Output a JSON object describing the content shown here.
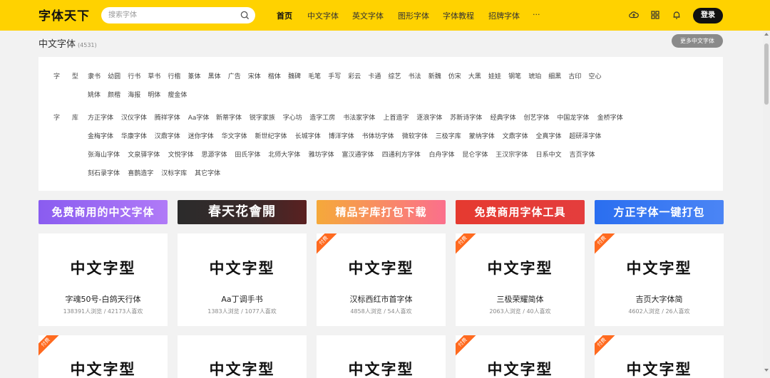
{
  "header": {
    "logo": "字体天下",
    "search_placeholder": "搜索字体",
    "nav": [
      "首页",
      "中文字体",
      "英文字体",
      "图形字体",
      "字体教程",
      "招牌字体",
      "···"
    ],
    "login_label": "登录",
    "icons": [
      "upload-icon",
      "grid-icon",
      "bell-icon"
    ]
  },
  "section": {
    "title": "中文字体",
    "count": "(4531)",
    "more_label": "更多中文字体"
  },
  "filters": {
    "type_label": "字 型",
    "types_row1": [
      "隶书",
      "幼圆",
      "行书",
      "草书",
      "行楷",
      "篆体",
      "黑体",
      "广告",
      "宋体",
      "楷体",
      "魏碑",
      "毛笔",
      "手写",
      "彩云",
      "卡通",
      "综艺",
      "书法",
      "新魏",
      "仿宋",
      "大黑",
      "娃娃",
      "钢笔",
      "琥珀",
      "细黑",
      "古印",
      "空心"
    ],
    "types_row2": [
      "姚体",
      "颜楷",
      "海报",
      "明体",
      "瘦金体"
    ],
    "lib_label": "字 库",
    "libs_row1": [
      "方正字体",
      "汉仪字体",
      "腾祥字体",
      "Aa字体",
      "新蒂字体",
      "锐字家族",
      "字心坊",
      "造字工房",
      "书法家字体",
      "上首造字",
      "逐浪字体",
      "苏新诗字体",
      "经典字体",
      "创艺字体",
      "中国龙字体",
      "金桥字体"
    ],
    "libs_row2": [
      "金梅字体",
      "华康字体",
      "汉鼎字体",
      "迷你字体",
      "华文字体",
      "新世纪字体",
      "长城字体",
      "博洋字体",
      "书体坊字体",
      "微软字体",
      "三极字库",
      "蒙纳字体",
      "文鼎字体",
      "全真字体",
      "超研泽字体"
    ],
    "libs_row3": [
      "张海山字体",
      "文泉驿字体",
      "文悦字体",
      "思源字体",
      "田氏字体",
      "北师大字体",
      "雅坊字体",
      "富汉通字体",
      "四通利方字体",
      "白舟字体",
      "昆仑字体",
      "王汉宗字体",
      "日系中文",
      "吉页字体"
    ],
    "libs_row4": [
      "刻石录字体",
      "喜鹊造字",
      "汉标字库",
      "其它字体"
    ]
  },
  "banners": [
    "免费商用的中文字体",
    "春天花會開",
    "精品字库打包下载",
    "免费商用字体工具",
    "方正字体一键打包"
  ],
  "cards": [
    {
      "preview": "中文字型",
      "name": "字魂50号-白鸽天行体",
      "stats": "138391人浏览 / 42173人喜欢",
      "paid": ""
    },
    {
      "preview": "中文字型",
      "name": "Aa丁调手书",
      "stats": "1383人浏览 / 1077人喜欢",
      "paid": ""
    },
    {
      "preview": "中文字型",
      "name": "汉标西红市首字体",
      "stats": "4858人浏览 / 54人喜欢",
      "paid": "付费"
    },
    {
      "preview": "中文字型",
      "name": "三极荣耀简体",
      "stats": "2063人浏览 / 40人喜欢",
      "paid": "付费"
    },
    {
      "preview": "中文字型",
      "name": "吉页大字体简",
      "stats": "4602人浏览 / 26人喜欢",
      "paid": "付费"
    }
  ],
  "cards_row2": [
    {
      "preview": "中文字型",
      "paid": "付费"
    },
    {
      "preview": "中文字型",
      "paid": ""
    },
    {
      "preview": "中文字型",
      "paid": ""
    },
    {
      "preview": "中文字型",
      "paid": "付费"
    },
    {
      "preview": "中文字型",
      "paid": "付费"
    }
  ],
  "colors": {
    "header_bg": "#ffd200",
    "paid_tag": "#ff6a1f",
    "login_bg": "#111111"
  }
}
